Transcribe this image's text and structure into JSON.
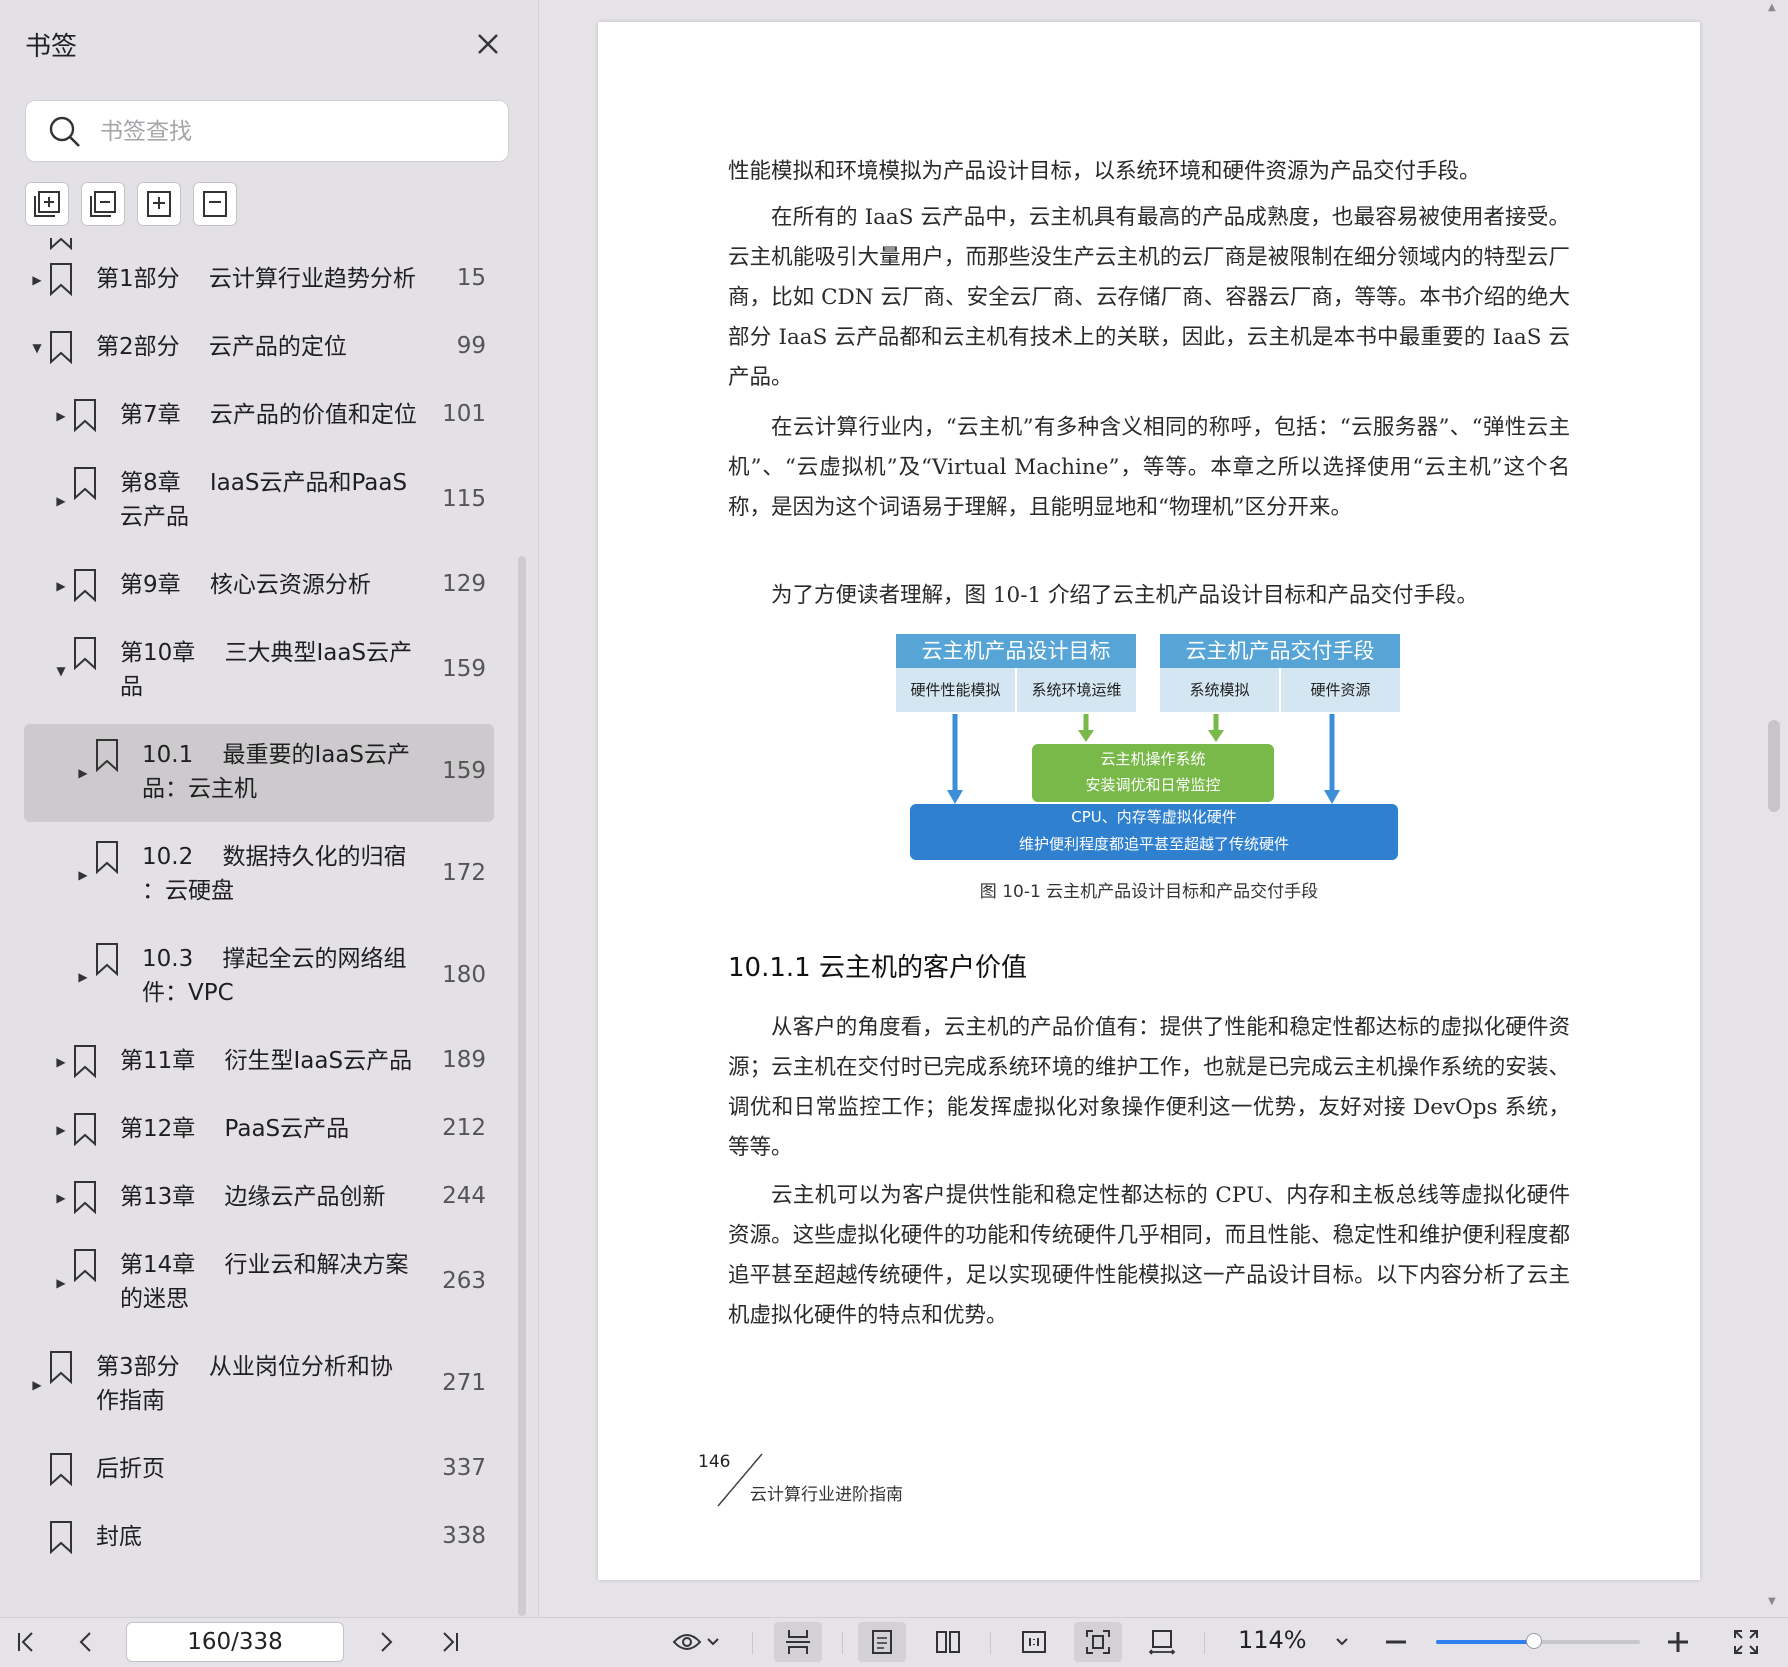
{
  "sidebar": {
    "title": "书签",
    "search_placeholder": "书签查找",
    "partial_top_page": "-",
    "items": [
      {
        "label": "第1部分    云计算行业趋势分析",
        "page": "15",
        "level": 0,
        "arrow": "right"
      },
      {
        "label": "第2部分    云产品的定位",
        "page": "99",
        "level": 0,
        "arrow": "down"
      },
      {
        "label": "第7章    云产品的价值和定位",
        "page": "101",
        "level": 1,
        "arrow": "right"
      },
      {
        "label": "第8章    IaaS云产品和PaaS\n云产品",
        "page": "115",
        "level": 1,
        "arrow": "right"
      },
      {
        "label": "第9章    核心云资源分析",
        "page": "129",
        "level": 1,
        "arrow": "right"
      },
      {
        "label": "第10章    三大典型IaaS云产\n品",
        "page": "159",
        "level": 1,
        "arrow": "down"
      },
      {
        "label": "10.1    最重要的IaaS云产\n品：云主机",
        "page": "159",
        "level": 2,
        "arrow": "right",
        "selected": true
      },
      {
        "label": "10.2    数据持久化的归宿\n：云硬盘",
        "page": "172",
        "level": 2,
        "arrow": "right"
      },
      {
        "label": "10.3    撑起全云的网络组\n件：VPC",
        "page": "180",
        "level": 2,
        "arrow": "right"
      },
      {
        "label": "第11章    衍生型IaaS云产品",
        "page": "189",
        "level": 1,
        "arrow": "right"
      },
      {
        "label": "第12章    PaaS云产品",
        "page": "212",
        "level": 1,
        "arrow": "right"
      },
      {
        "label": "第13章    边缘云产品创新",
        "page": "244",
        "level": 1,
        "arrow": "right"
      },
      {
        "label": "第14章    行业云和解决方案\n的迷思",
        "page": "263",
        "level": 1,
        "arrow": "right"
      },
      {
        "label": "第3部分    从业岗位分析和协\n作指南",
        "page": "271",
        "level": 0,
        "arrow": "right"
      },
      {
        "label": "后折页",
        "page": "337",
        "level": 0,
        "arrow": "none"
      },
      {
        "label": "封底",
        "page": "338",
        "level": 0,
        "arrow": "none"
      }
    ]
  },
  "document": {
    "paragraphs": [
      "性能模拟和环境模拟为产品设计目标，以系统环境和硬件资源为产品交付手段。",
      "在所有的 IaaS 云产品中，云主机具有最高的产品成熟度，也最容易被使用者接受。云主机能吸引大量用户，而那些没生产云主机的云厂商是被限制在细分领域内的特型云厂商，比如 CDN 云厂商、安全云厂商、云存储厂商、容器云厂商，等等。本书介绍的绝大部分 IaaS 云产品都和云主机有技术上的关联，因此，云主机是本书中最重要的 IaaS 云产品。",
      "在云计算行业内，“云主机”有多种含义相同的称呼，包括：“云服务器”、“弹性云主机”、“云虚拟机”及“Virtual Machine”，等等。本章之所以选择使用“云主机”这个名称，是因为这个词语易于理解，且能明显地和“物理机”区分开来。",
      "为了方便读者理解，图 10-1 介绍了云主机产品设计目标和产品交付手段。"
    ],
    "figure": {
      "left_header": "云主机产品设计目标",
      "right_header": "云主机产品交付手段",
      "left_items": [
        "硬件性能模拟",
        "系统环境运维"
      ],
      "right_items": [
        "系统模拟",
        "硬件资源"
      ],
      "green_box_line1": "云主机操作系统",
      "green_box_line2": "安装调优和日常监控",
      "blue_box_line1": "CPU、内存等虚拟化硬件",
      "blue_box_line2": "维护便利程度都追平甚至超越了传统硬件",
      "caption": "图 10-1    云主机产品设计目标和产品交付手段",
      "colors": {
        "header": "#56a5d6",
        "sub": "#d5e6f3",
        "green": "#79b94a",
        "blue": "#2f80cf"
      }
    },
    "section_heading": "10.1.1    云主机的客户价值",
    "paragraphs2": [
      "从客户的角度看，云主机的产品价值有：提供了性能和稳定性都达标的虚拟化硬件资源；云主机在交付时已完成系统环境的维护工作，也就是已完成云主机操作系统的安装、调优和日常监控工作；能发挥虚拟化对象操作便利这一优势，友好对接 DevOps 系统，等等。",
      "云主机可以为客户提供性能和稳定性都达标的 CPU、内存和主板总线等虚拟化硬件资源。这些虚拟化硬件的功能和传统硬件几乎相同，而且性能、稳定性和维护便利程度都追平甚至超越传统硬件，足以实现硬件性能模拟这一产品设计目标。以下内容分析了云主机虚拟化硬件的特点和优势。"
    ],
    "page_number": "146",
    "book_title": "云计算行业进阶指南"
  },
  "bottombar": {
    "page_indicator": "160/338",
    "zoom": "114%",
    "zoom_fraction": 0.48,
    "accent": "#2f7ff1"
  }
}
